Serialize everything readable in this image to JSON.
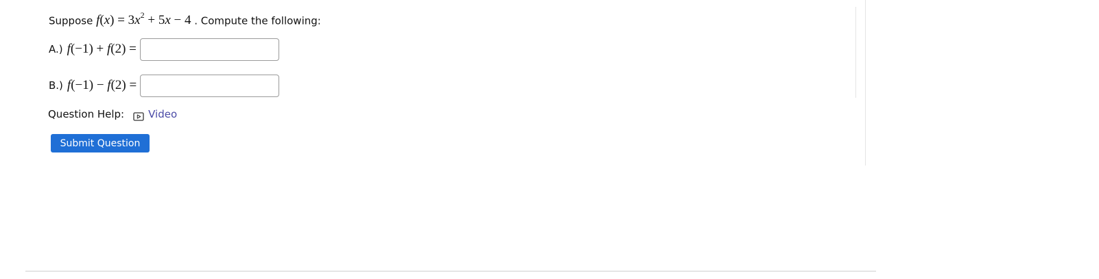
{
  "question": {
    "prefix": "Suppose",
    "function_expr": "f(x) = 3x² + 5x − 4",
    "suffix": ". Compute the following:"
  },
  "parts": [
    {
      "label": "A.)",
      "expression": "f(−1) + f(2) =",
      "input_value": ""
    },
    {
      "label": "B.)",
      "expression": "f(−1) − f(2) =",
      "input_value": ""
    }
  ],
  "help": {
    "label": "Question Help:",
    "video_icon": "video-play-icon",
    "video_link": "Video"
  },
  "submit_label": "Submit Question"
}
